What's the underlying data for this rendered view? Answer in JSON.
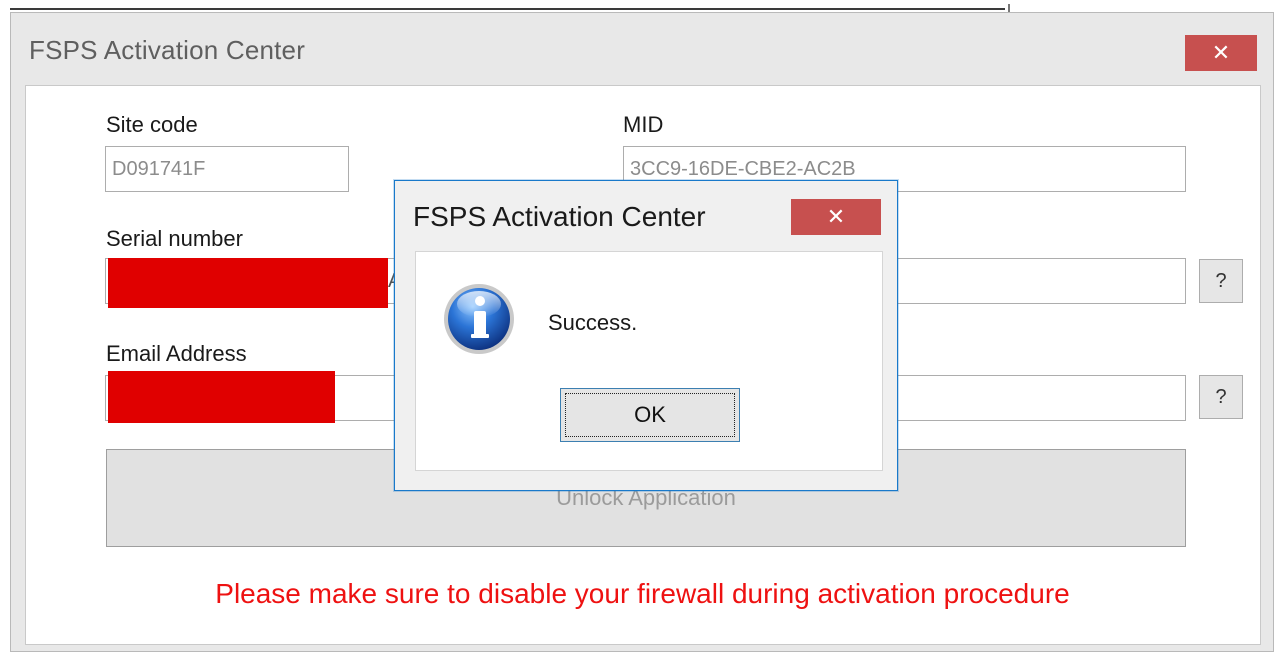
{
  "main_window": {
    "title": "FSPS Activation Center",
    "close_glyph": "✕",
    "site_code": {
      "label": "Site code",
      "value": "D091741F"
    },
    "mid": {
      "label": "MID",
      "value": "3CC9-16DE-CBE2-AC2B"
    },
    "serial_number": {
      "label": "Serial number",
      "value": "",
      "visible_fragment": "A",
      "help_label": "?"
    },
    "email_address": {
      "label": "Email Address",
      "value": "",
      "help_label": "?"
    },
    "unlock_button": "Unlock Application",
    "warning": "Please make sure to disable your firewall during activation procedure"
  },
  "message_box": {
    "title": "FSPS Activation Center",
    "close_glyph": "✕",
    "icon": "info-icon",
    "message": "Success.",
    "ok_label": "OK"
  },
  "colors": {
    "close_button": "#c7504f",
    "warning_text": "#ee1111",
    "redaction": "#e00000",
    "dialog_border": "#1979ca"
  }
}
